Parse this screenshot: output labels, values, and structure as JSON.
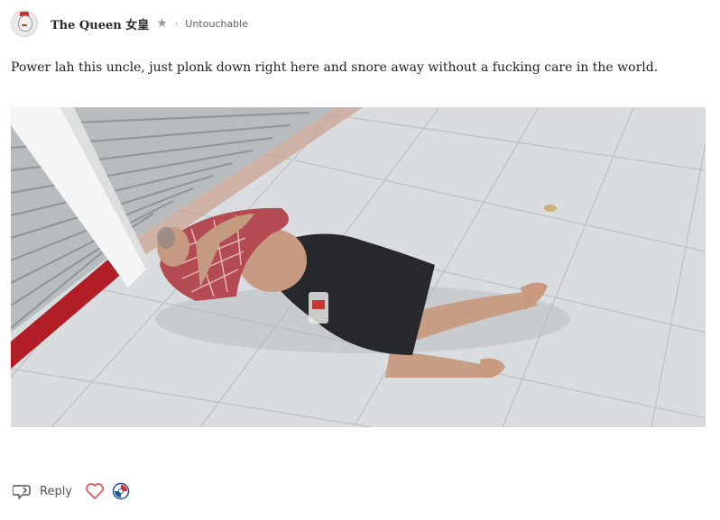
{
  "post": {
    "author": "The Queen 女皇",
    "separator": "·",
    "flair": "Untouchable",
    "body": "Power lah this uncle, just plonk down right here and snore away without a fucking care in the world."
  },
  "actions": {
    "reply_label": "Reply"
  },
  "icons": {
    "avatar": "queen-avatar-icon",
    "star": "star-icon",
    "reply": "reply-arrow-icon",
    "like": "heart-icon",
    "badge": "singapore-badge-icon"
  },
  "colors": {
    "heart": "#e4575c",
    "badge_red": "#d62f2a",
    "badge_blue": "#1f4fa8",
    "muted_text": "#777777"
  }
}
